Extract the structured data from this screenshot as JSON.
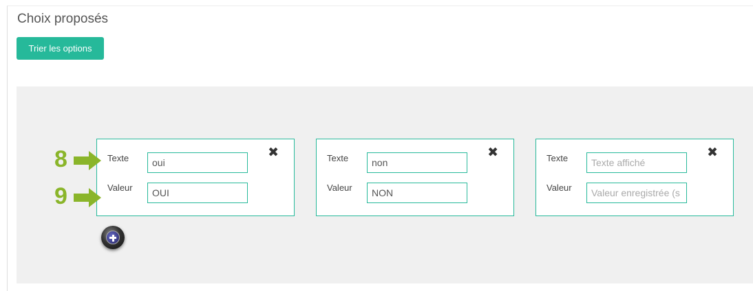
{
  "section": {
    "title": "Choix proposés",
    "sort_button_label": "Trier les options"
  },
  "options": [
    {
      "texte_label": "Texte",
      "valeur_label": "Valeur",
      "texte_value": "oui",
      "valeur_value": "OUI",
      "texte_placeholder": "",
      "valeur_placeholder": "",
      "remove_icon": "✖"
    },
    {
      "texte_label": "Texte",
      "valeur_label": "Valeur",
      "texte_value": "non",
      "valeur_value": "NON",
      "texte_placeholder": "",
      "valeur_placeholder": "",
      "remove_icon": "✖"
    },
    {
      "texte_label": "Texte",
      "valeur_label": "Valeur",
      "texte_value": "",
      "valeur_value": "",
      "texte_placeholder": "Texte affiché",
      "valeur_placeholder": "Valeur enregistrée (s",
      "remove_icon": "✖"
    }
  ],
  "annotations": [
    {
      "number": "8",
      "color": "#8ab52a"
    },
    {
      "number": "9",
      "color": "#8ab52a"
    }
  ],
  "icons": {
    "add_option": "add-circle-icon",
    "arrow": "arrow-right-icon"
  },
  "colors": {
    "accent": "#26b99a",
    "annotation": "#8ab52a",
    "area_background": "#f0f0f0"
  }
}
